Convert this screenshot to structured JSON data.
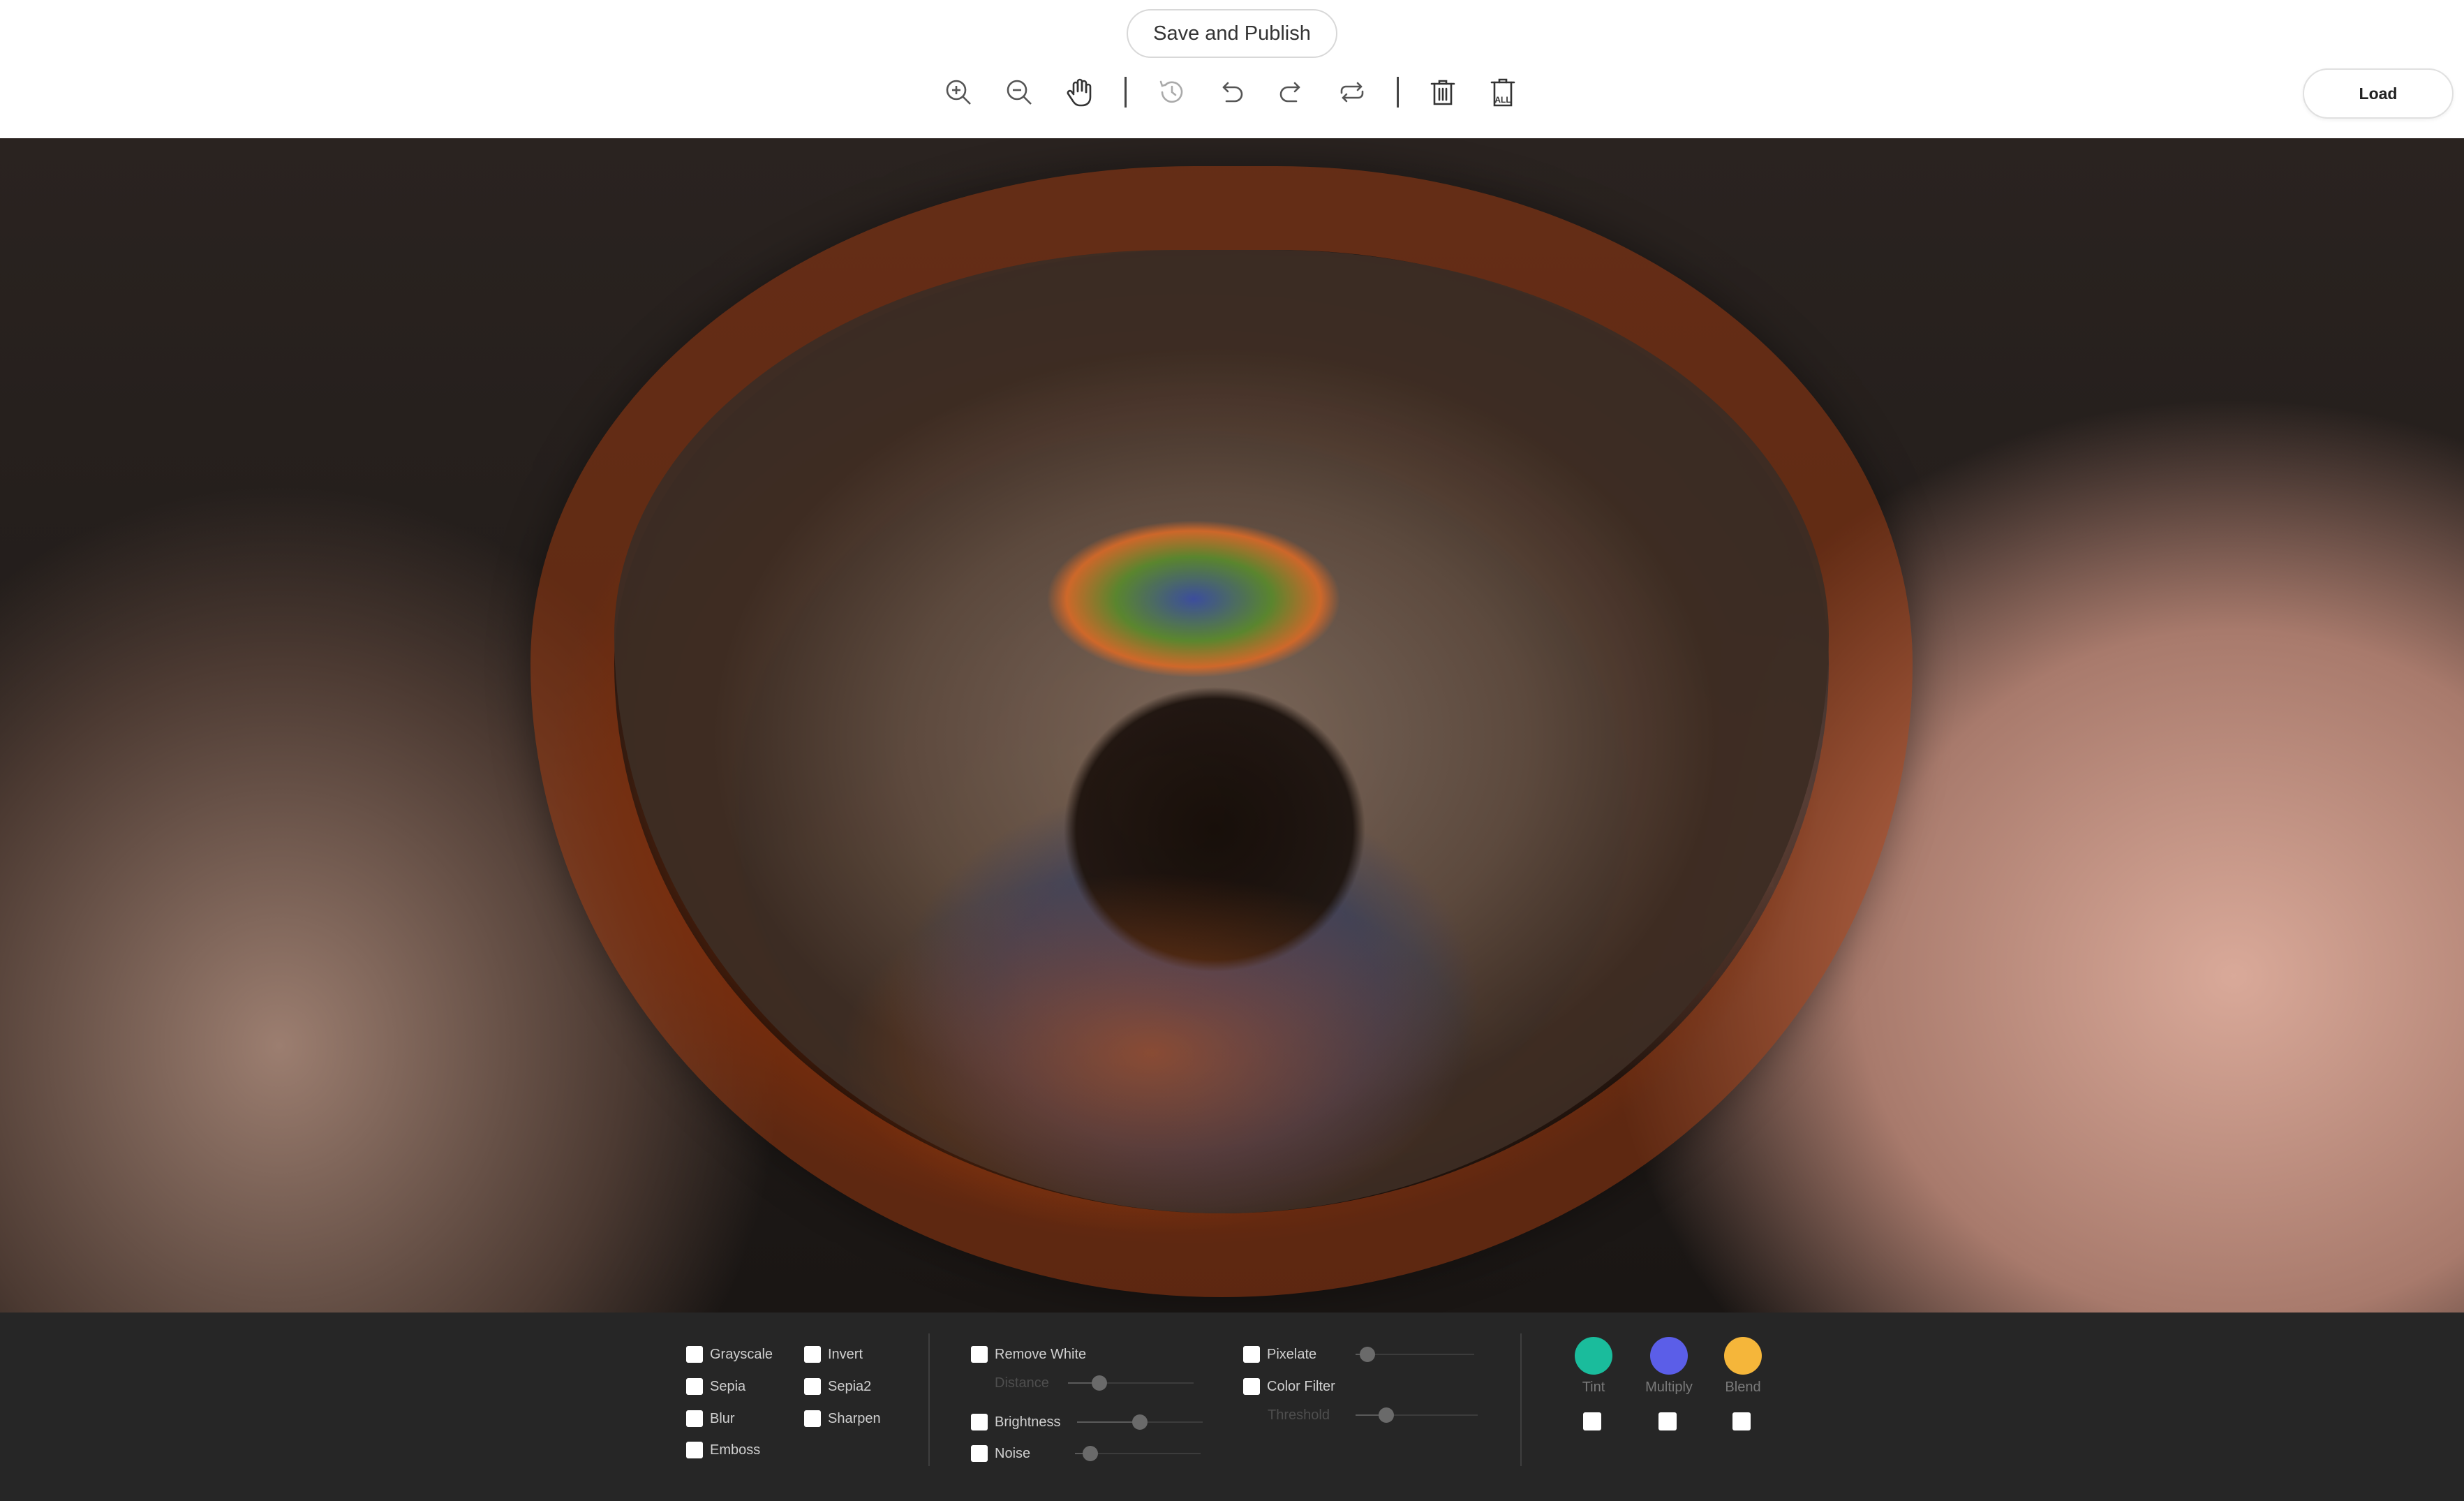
{
  "header": {
    "save_label": "Save and Publish",
    "load_label": "Load",
    "delete_all_label": "ALL"
  },
  "toolbar": {
    "icons": [
      "zoom-in-icon",
      "zoom-out-icon",
      "hand-pan-icon",
      "history-icon",
      "undo-icon",
      "redo-icon",
      "reset-icon",
      "delete-icon",
      "delete-all-icon"
    ]
  },
  "filters": {
    "group1": {
      "grayscale": "Grayscale",
      "invert": "Invert",
      "sepia": "Sepia",
      "sepia2": "Sepia2",
      "blur": "Blur",
      "sharpen": "Sharpen",
      "emboss": "Emboss"
    },
    "group2": {
      "remove_white": "Remove White",
      "distance": "Distance",
      "brightness": "Brightness",
      "noise": "Noise"
    },
    "group3": {
      "pixelate": "Pixelate",
      "color_filter": "Color Filter",
      "threshold": "Threshold"
    },
    "group4": {
      "tint": "Tint",
      "multiply": "Multiply",
      "blend": "Blend"
    }
  },
  "sliders": {
    "distance": 0.25,
    "brightness": 0.5,
    "noise": 0.12,
    "pixelate": 0.1,
    "threshold": 0.25
  },
  "colors": {
    "tint": "#1abc9c",
    "multiply": "#5b5ee8",
    "blend": "#f5b63a",
    "panel_bg": "#262626"
  }
}
